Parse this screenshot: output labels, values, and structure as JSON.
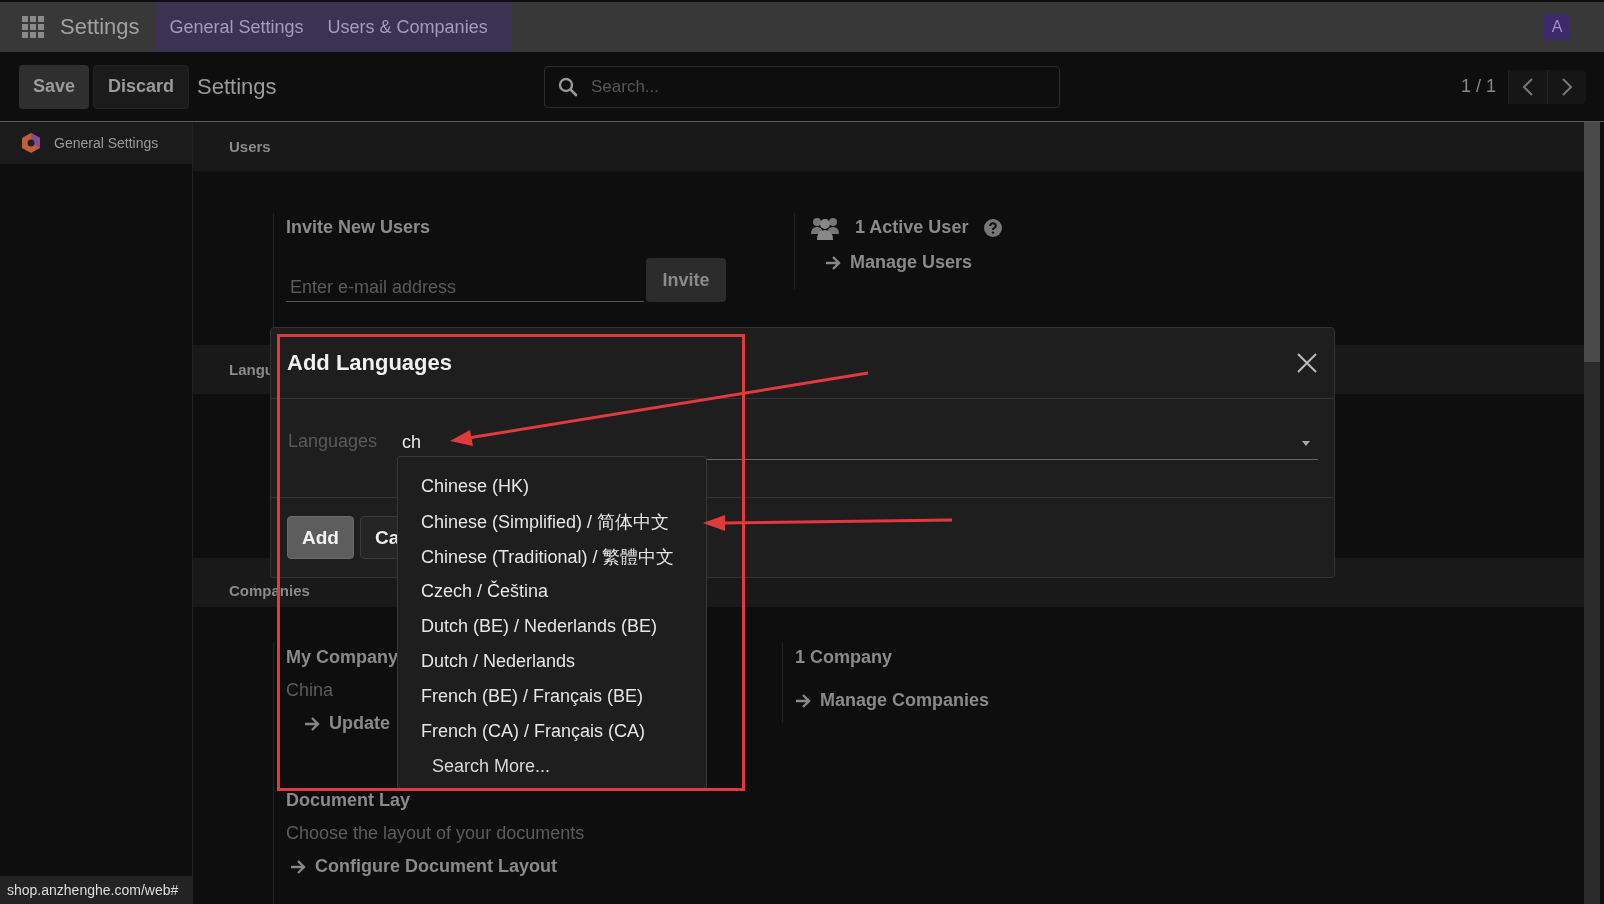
{
  "navbar": {
    "app_name": "Settings",
    "menu": [
      {
        "label": "General Settings"
      },
      {
        "label": "Users & Companies"
      }
    ],
    "avatar": "A"
  },
  "control_panel": {
    "buttons": [
      "Save",
      "Discard"
    ],
    "title": "Settings",
    "search": {
      "placeholder": "Search..."
    },
    "pager": "1 / 1"
  },
  "sidebar": {
    "items": [
      {
        "label": "General Settings",
        "selected": true
      }
    ]
  },
  "users_section": {
    "title": "Users",
    "invite": {
      "title": "Invite New Users",
      "placeholder": "Enter e-mail address",
      "button": "Invite"
    },
    "active_users": {
      "title": "1 Active User",
      "link": "Manage Users"
    }
  },
  "languages_section": {
    "title": "Langu"
  },
  "companies_section": {
    "title": "Companies",
    "company": {
      "name": "My Company",
      "country": "China",
      "link": "Update"
    },
    "document_layout": {
      "title": "Document Lay",
      "description": "Choose the layout of your documents",
      "link": "Configure Document Layout"
    },
    "companies": {
      "title": "1 Company",
      "link": "Manage Companies"
    }
  },
  "dialog": {
    "title": "Add Languages",
    "field": {
      "label": "Languages",
      "value": "ch"
    },
    "options": [
      {
        "label": "Chinese (HK)",
        "kind": "option"
      },
      {
        "label": "Chinese (Simplified) / 简体中文",
        "kind": "option"
      },
      {
        "label": "Chinese (Traditional) / 繁體中文",
        "kind": "option"
      },
      {
        "label": "Czech / Čeština",
        "kind": "option"
      },
      {
        "label": "Dutch (BE) / Nederlands (BE)",
        "kind": "option"
      },
      {
        "label": "Dutch / Nederlands",
        "kind": "option"
      },
      {
        "label": "French (BE) / Français (BE)",
        "kind": "option"
      },
      {
        "label": "French (CA) / Français (CA)",
        "kind": "option"
      },
      {
        "label": "Search More...",
        "kind": "search_more"
      }
    ],
    "buttons": [
      "Add",
      "Ca"
    ]
  },
  "status_bar": "shop.anzhenghe.com/web#"
}
